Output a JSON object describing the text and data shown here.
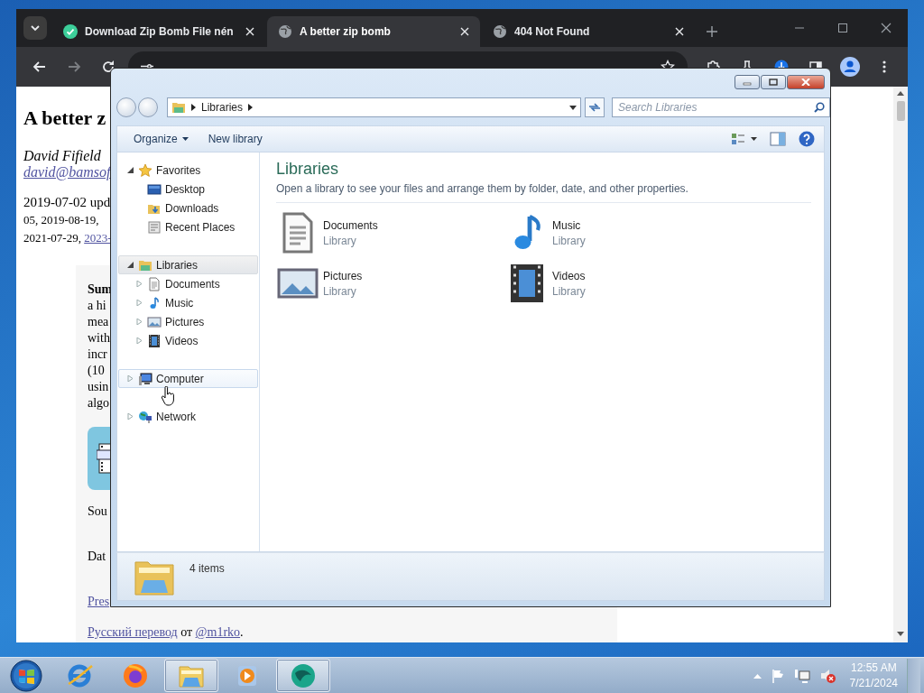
{
  "browser": {
    "tabs": [
      {
        "title": "Download Zip Bomb File nén",
        "kind": "check",
        "selected": false
      },
      {
        "title": "A better zip bomb",
        "kind": "globe",
        "selected": true
      },
      {
        "title": "404 Not Found",
        "kind": "globe",
        "selected": false
      }
    ],
    "page": {
      "title": "A better z",
      "author": "David Fifield",
      "email": "david@bamsof",
      "dates": [
        {
          "text": "2019-07-02 upd"
        },
        {
          "text": "05, 2019-08-19,"
        },
        {
          "text": "2021-07-29,",
          "link": "2023-"
        }
      ],
      "summary": [
        {
          "text": "Sum",
          "bold": true
        },
        {
          "text": "a hi",
          "bold": false
        },
        {
          "text": "mea",
          "bold": false
        },
        {
          "text": "with",
          "bold": false
        },
        {
          "text": "incr",
          "bold": false
        },
        {
          "text": "(10",
          "bold": false
        },
        {
          "text": "usin",
          "bold": false
        },
        {
          "text": "algo",
          "bold": false
        }
      ],
      "paragraphs": [
        {
          "kind": "text",
          "text": "Sou"
        },
        {
          "kind": "text",
          "text": "Dat"
        },
        {
          "kind": "link",
          "text": "Pres"
        }
      ],
      "translation": {
        "link": "Русский перевод",
        "middle": "от",
        "handle": "@m1rko",
        "end": "."
      }
    }
  },
  "explorer": {
    "location": "Libraries",
    "search_placeholder": "Search Libraries",
    "toolbar": [
      {
        "label": "Organize",
        "kind": "menu"
      },
      {
        "label": "New library",
        "kind": "button"
      }
    ],
    "nav": [
      {
        "label": "Favorites",
        "kind": "favorites",
        "expanded": true,
        "selected": false,
        "hovered": false,
        "children": [
          {
            "label": "Desktop",
            "kind": "desktop"
          },
          {
            "label": "Downloads",
            "kind": "downloads"
          },
          {
            "label": "Recent Places",
            "kind": "recent"
          }
        ]
      },
      {
        "label": "Libraries",
        "kind": "libraries",
        "expanded": true,
        "selected": true,
        "hovered": false,
        "children": [
          {
            "label": "Documents",
            "kind": "documents",
            "expanded": false
          },
          {
            "label": "Music",
            "kind": "music",
            "expanded": false
          },
          {
            "label": "Pictures",
            "kind": "pictures",
            "expanded": false
          },
          {
            "label": "Videos",
            "kind": "videos",
            "expanded": false
          }
        ]
      },
      {
        "label": "Computer",
        "kind": "computer",
        "expanded": false,
        "selected": false,
        "hovered": true
      },
      {
        "label": "Network",
        "kind": "network",
        "expanded": false,
        "selected": false,
        "hovered": false
      }
    ],
    "heading": "Libraries",
    "subtitle": "Open a library to see your files and arrange them by folder, date, and other properties.",
    "items": [
      {
        "name": "Documents",
        "type": "Library",
        "kind": "documents"
      },
      {
        "name": "Music",
        "type": "Library",
        "kind": "music"
      },
      {
        "name": "Pictures",
        "type": "Library",
        "kind": "pictures"
      },
      {
        "name": "Videos",
        "type": "Library",
        "kind": "videos"
      }
    ],
    "status": "4 items"
  },
  "taskbar": {
    "apps": [
      {
        "kind": "ie",
        "active": false
      },
      {
        "kind": "firefox",
        "active": false
      },
      {
        "kind": "explorer",
        "active": true
      },
      {
        "kind": "media",
        "active": false
      },
      {
        "kind": "sphere",
        "active": true
      }
    ],
    "time": "12:55 AM",
    "date": "7/21/2024"
  }
}
